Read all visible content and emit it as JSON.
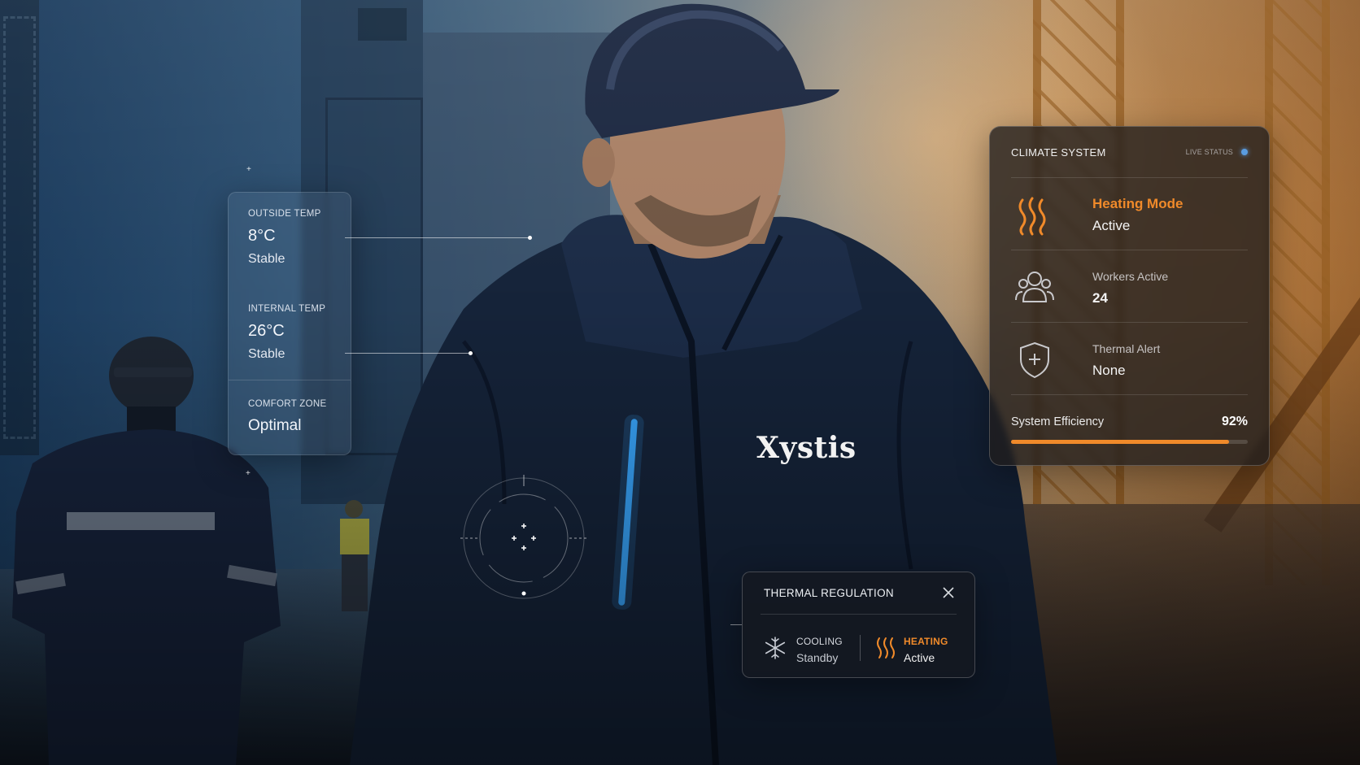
{
  "brand": {
    "jacket_logo": "Xystis"
  },
  "environment_panel": {
    "outside_temp": {
      "caption": "OUTSIDE TEMP",
      "value": "8°C",
      "status": "Stable"
    },
    "internal_temp": {
      "caption": "INTERNAL TEMP",
      "value": "26°C",
      "status": "Stable"
    },
    "comfort_zone": {
      "caption": "COMFORT ZONE",
      "value": "Optimal"
    }
  },
  "climate_system": {
    "title": "CLIMATE SYSTEM",
    "live_status": "LIVE STATUS",
    "rows": [
      {
        "icon": "heat-waves-icon",
        "label": "Heating Mode",
        "value": "Active"
      },
      {
        "icon": "people-icon",
        "label": "Workers Active",
        "value": "24"
      },
      {
        "icon": "shield-plus-icon",
        "label": "Thermal Alert",
        "value": "None"
      }
    ],
    "efficiency": {
      "label": "System Efficiency",
      "value": "92%",
      "fraction": 0.92
    }
  },
  "thermal_regulation": {
    "title": "THERMAL REGULATION",
    "cooling": {
      "icon": "snowflake-icon",
      "caption": "COOLING",
      "status": "Standby"
    },
    "heating": {
      "icon": "heat-waves-icon",
      "caption": "HEATING",
      "status": "Active"
    }
  },
  "colors": {
    "accent": "#f08a2a",
    "live_dot": "#5a9ce0",
    "jacket_led": "#3aa8ff"
  }
}
